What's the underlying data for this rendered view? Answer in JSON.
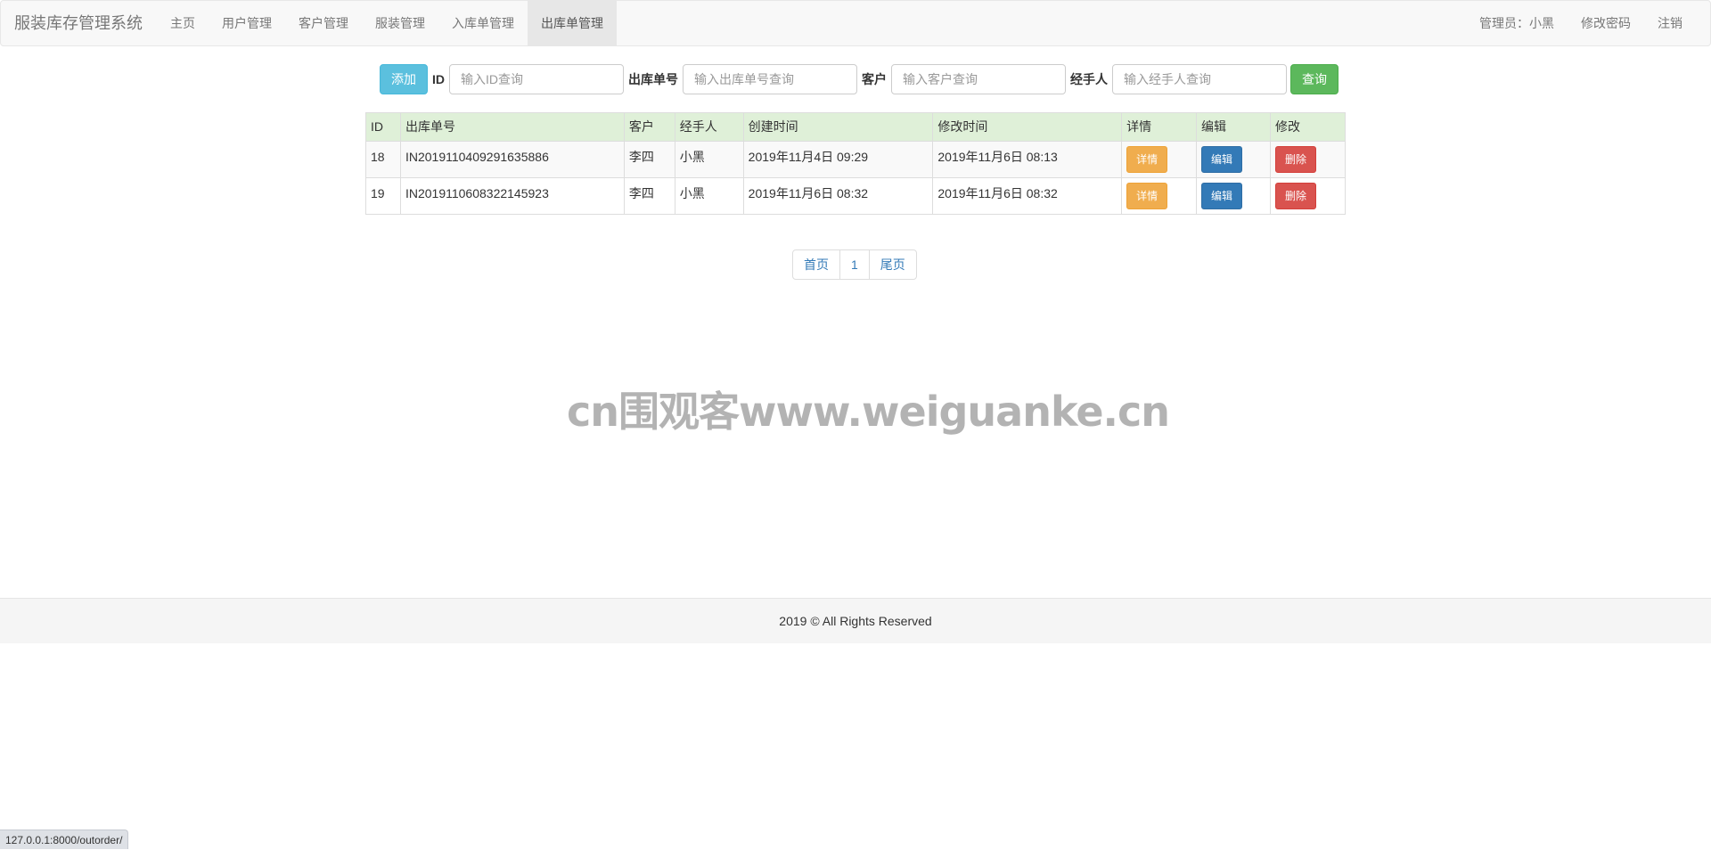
{
  "navbar": {
    "brand": "服装库存管理系统",
    "items": [
      {
        "label": "主页"
      },
      {
        "label": "用户管理"
      },
      {
        "label": "客户管理"
      },
      {
        "label": "服装管理"
      },
      {
        "label": "入库单管理"
      },
      {
        "label": "出库单管理",
        "active": true
      }
    ],
    "right": {
      "admin": "管理员：小黑",
      "change_password": "修改密码",
      "logout": "注销"
    }
  },
  "search": {
    "add_label": "添加",
    "id_label": "ID",
    "id_placeholder": "输入ID查询",
    "order_label": "出库单号",
    "order_placeholder": "输入出库单号查询",
    "customer_label": "客户",
    "customer_placeholder": "输入客户查询",
    "handler_label": "经手人",
    "handler_placeholder": "输入经手人查询",
    "query_label": "查询"
  },
  "table": {
    "columns": [
      "ID",
      "出库单号",
      "客户",
      "经手人",
      "创建时间",
      "修改时间",
      "详情",
      "编辑",
      "修改"
    ],
    "rows": [
      {
        "id": "18",
        "order_no": "IN2019110409291635886",
        "customer": "李四",
        "handler": "小黑",
        "created": "2019年11月4日 09:29",
        "modified": "2019年11月6日 08:13",
        "detail": "详情",
        "edit": "编辑",
        "delete": "删除"
      },
      {
        "id": "19",
        "order_no": "IN2019110608322145923",
        "customer": "李四",
        "handler": "小黑",
        "created": "2019年11月6日 08:32",
        "modified": "2019年11月6日 08:32",
        "detail": "详情",
        "edit": "编辑",
        "delete": "删除"
      }
    ]
  },
  "pagination": {
    "first": "首页",
    "page": "1",
    "last": "尾页"
  },
  "watermark": "cn围观客www.weiguanke.cn",
  "footer": {
    "text": "2019 © All Rights Reserved"
  },
  "status_url": "127.0.0.1:8000/outorder/",
  "colors": {
    "navbar_bg": "#f8f8f8",
    "header_row_bg": "#dff0d8",
    "btn_info": "#5bc0de",
    "btn_success": "#5cb85c",
    "btn_warning": "#f0ad4e",
    "btn_primary": "#337ab7",
    "btn_danger": "#d9534f",
    "link": "#337ab7"
  }
}
